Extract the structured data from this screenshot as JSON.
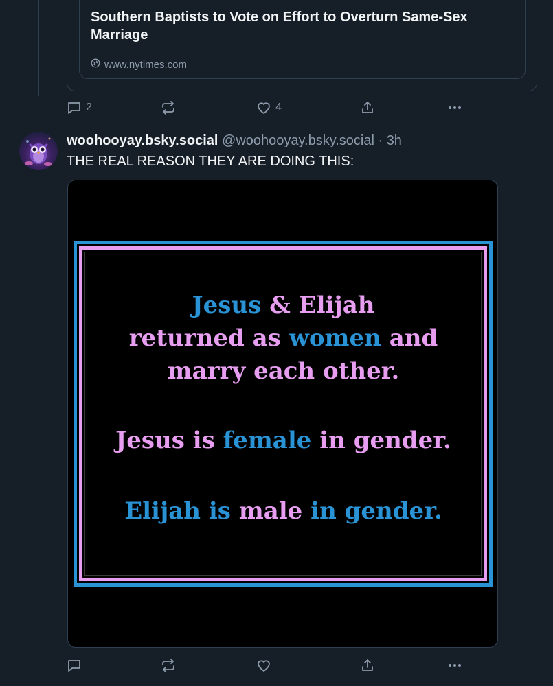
{
  "prev_post": {
    "link_title": "Southern Baptists to Vote on Effort to Overturn Same-Sex Marriage",
    "link_domain": "www.nytimes.com",
    "reply_count": "2",
    "like_count": "4"
  },
  "post": {
    "display_name": "woohooyay.bsky.social",
    "handle": "@woohooyay.bsky.social",
    "separator": " · ",
    "time": "3h",
    "text": "THE REAL REASON THEY ARE DOING THIS:",
    "image_text": {
      "l1a": "Jesus",
      "l1b": " & Elijah",
      "l2a": "returned as ",
      "l2b": "women",
      "l2c": " and",
      "l3": "marry each other.",
      "l4a": "Jesus is ",
      "l4b": "female",
      "l4c": " in gender.",
      "l5a": "Elijah is ",
      "l5b": "male",
      "l5c": " in gender."
    }
  },
  "icons": {
    "reply": "reply-icon",
    "repost": "repost-icon",
    "like": "heart-icon",
    "share": "share-icon",
    "more": "more-icon",
    "globe": "globe-icon"
  },
  "colors": {
    "background": "#161e27",
    "border": "#2e4052",
    "muted": "#8d9cad",
    "pink": "#e89ef0",
    "blue": "#2a93d5"
  }
}
